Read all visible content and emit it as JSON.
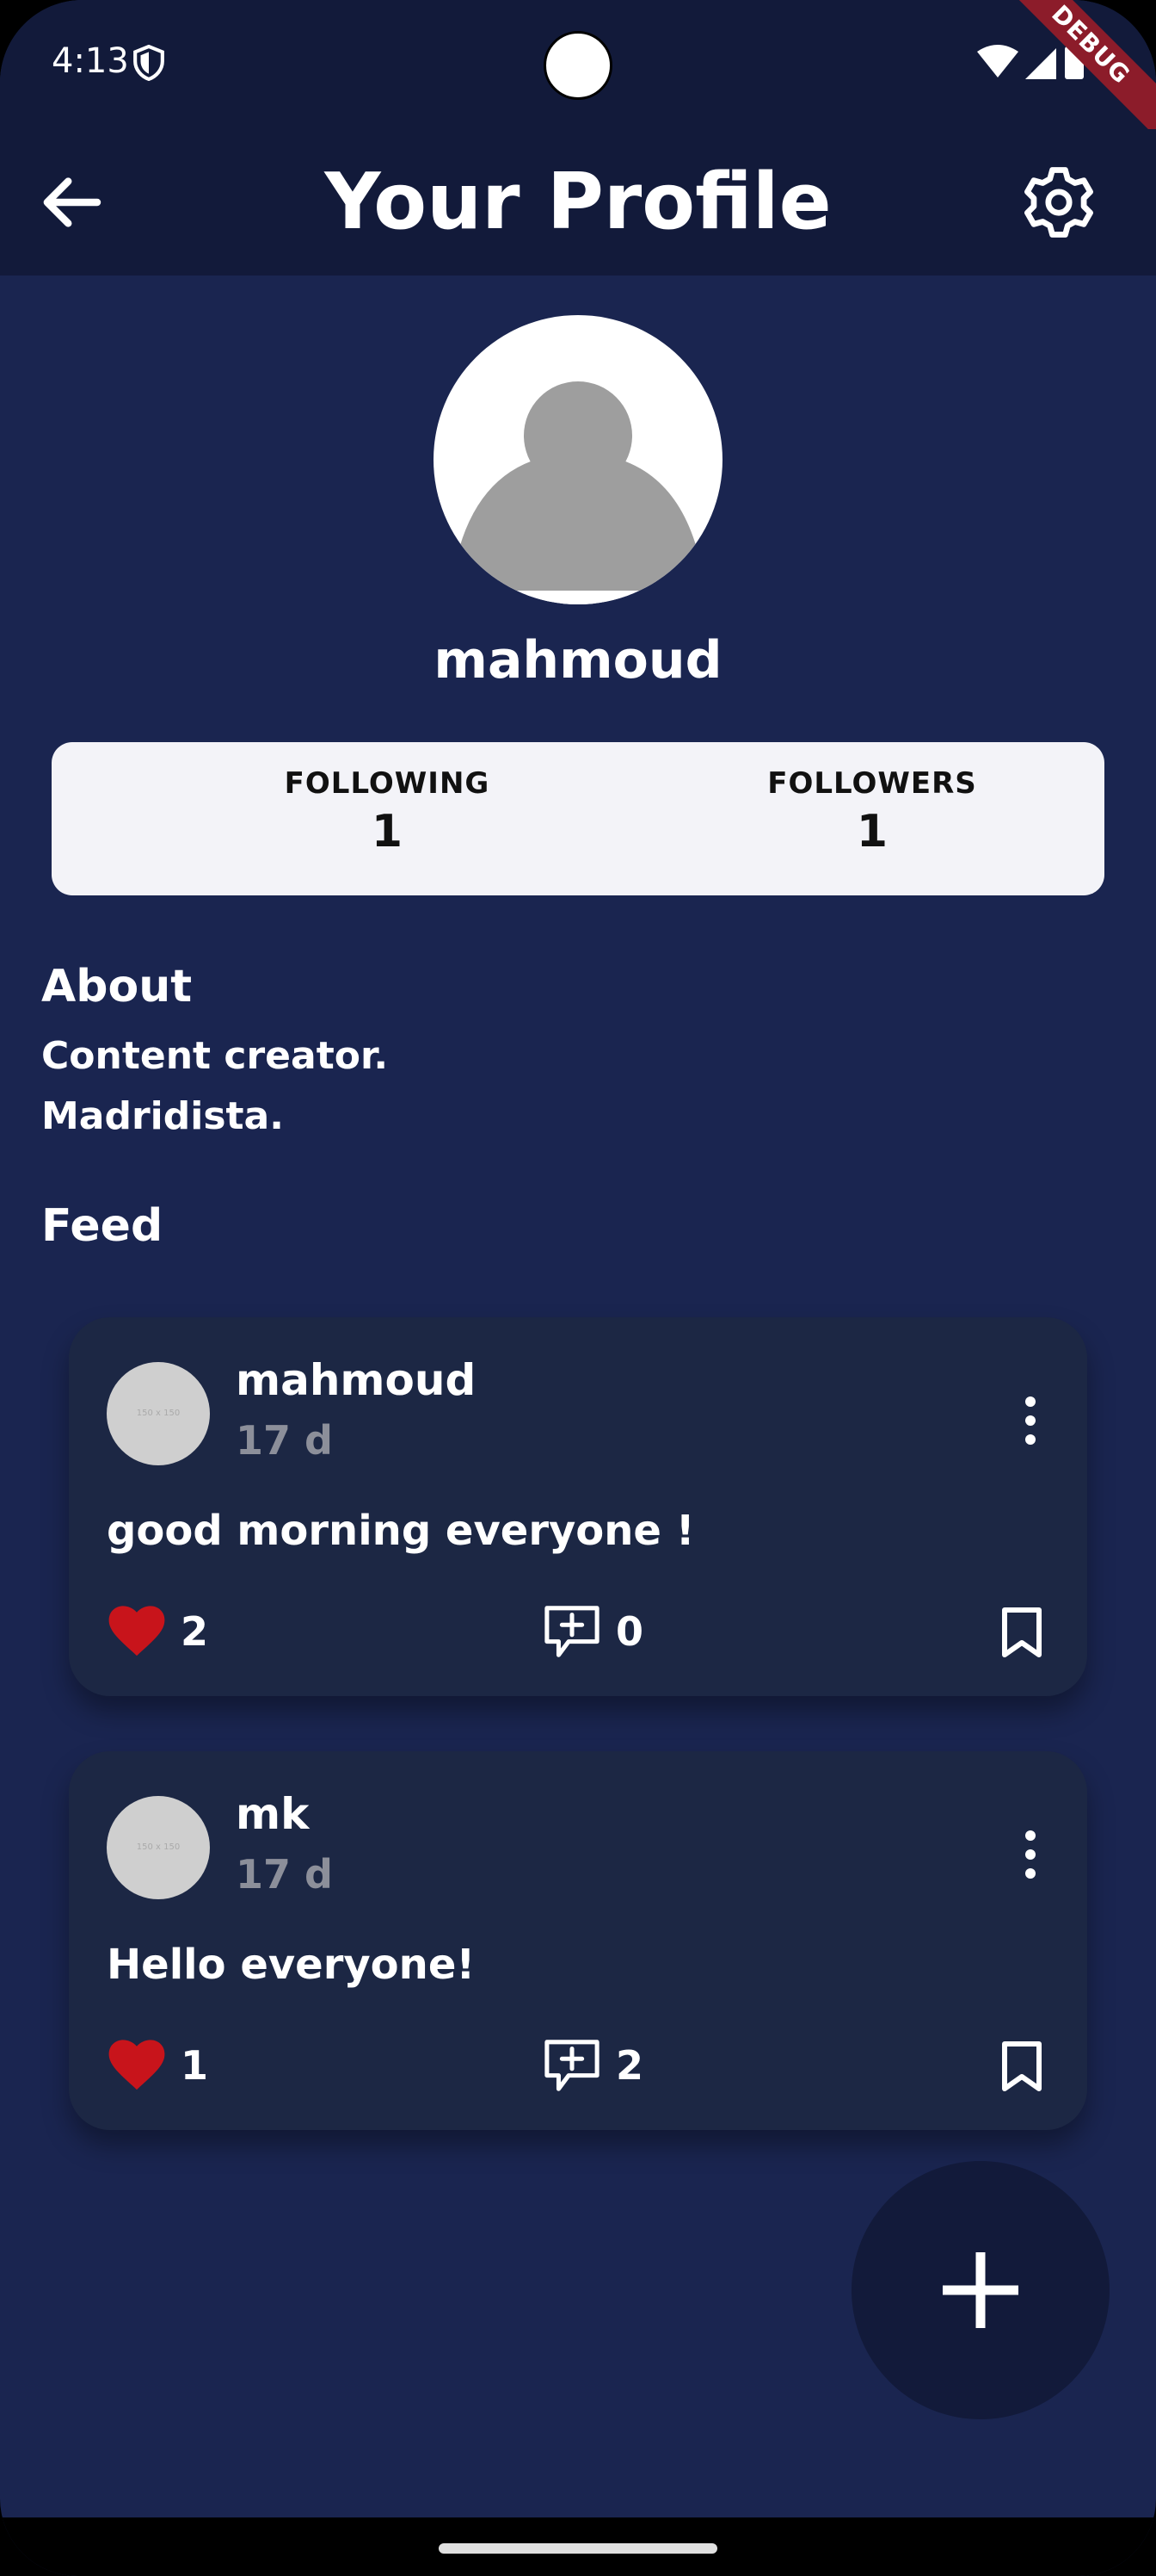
{
  "status_bar": {
    "time": "4:13",
    "debug_label": "DEBUG"
  },
  "app_bar": {
    "title": "Your Profile",
    "back_icon": "arrow-back-icon",
    "settings_icon": "gear-icon"
  },
  "profile": {
    "username": "mahmoud",
    "following_label": "FOLLOWING",
    "following_count": "1",
    "followers_label": "FOLLOWERS",
    "followers_count": "1"
  },
  "about": {
    "heading": "About",
    "line1": "Content creator.",
    "line2": "Madridista."
  },
  "feed": {
    "heading": "Feed",
    "posts": [
      {
        "author": "mahmoud",
        "time": "17 d",
        "avatar_placeholder": "150 x 150",
        "text": "good morning everyone !",
        "likes": "2",
        "comments": "0"
      },
      {
        "author": "mk",
        "time": "17 d",
        "avatar_placeholder": "150 x 150",
        "text": "Hello everyone!",
        "likes": "1",
        "comments": "2"
      }
    ]
  },
  "colors": {
    "background": "#1a2550",
    "app_bar": "#121a3a",
    "card": "#1c2744",
    "like_red": "#c8141b",
    "stats_card": "#f3f3f8"
  }
}
